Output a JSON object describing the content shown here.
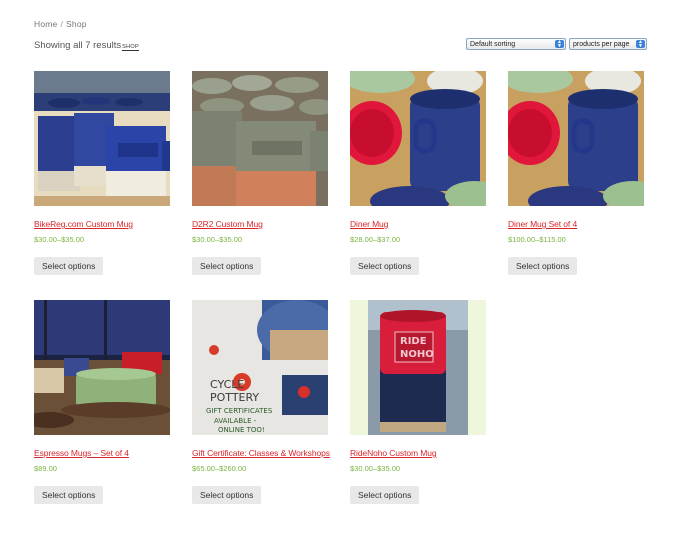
{
  "breadcrumb": {
    "home": "Home",
    "separator": "/",
    "current": "Shop"
  },
  "results": {
    "text": "Showing all 7 results",
    "shop_link": "SHOP"
  },
  "sorting": {
    "selected": "Default sorting"
  },
  "per_page": {
    "selected": "products per page"
  },
  "products": [
    {
      "title": "BikeReg.com Custom Mug",
      "price": "$30.00–$35.00",
      "button": "Select options"
    },
    {
      "title": "D2R2 Custom Mug",
      "price": "$30.00–$35.00",
      "button": "Select options"
    },
    {
      "title": "Diner Mug",
      "price": "$28.00–$37.00",
      "button": "Select options"
    },
    {
      "title": "Diner Mug Set of 4",
      "price": "$100.00–$115.00",
      "button": "Select options"
    },
    {
      "title": "Espresso Mugs – Set of 4",
      "price": "$89.00",
      "button": "Select options"
    },
    {
      "title": "Gift Certificate: Classes & Workshops",
      "price": "$65.00–$260.00",
      "button": "Select options"
    },
    {
      "title": "RideNoho Custom Mug",
      "price": "$30.00–$35.00",
      "button": "Select options"
    }
  ],
  "gift_card": {
    "line1": "CYCLE",
    "line2": "POTTERY",
    "line3": "GIFT CERTIFICATES",
    "line4": "AVAILABLE -",
    "line5": "ONLINE TOO!"
  },
  "ridenoho_stamp": {
    "line1": "RIDE",
    "line2": "NOHO"
  },
  "colors": {
    "title_red": "#d9262c",
    "price_green": "#7cb342",
    "button_bg": "#e8e8e8"
  }
}
